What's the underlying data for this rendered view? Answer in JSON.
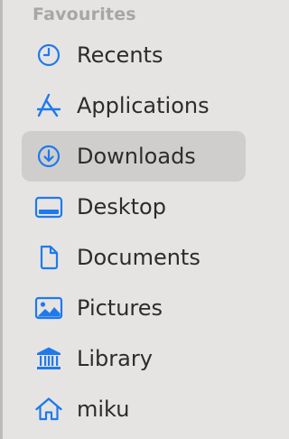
{
  "sidebar": {
    "section_title": "Favourites",
    "accent_color": "#1f7aec",
    "selected_index": 2,
    "items": [
      {
        "label": "Recents",
        "icon": "clock-icon",
        "selected": false
      },
      {
        "label": "Applications",
        "icon": "applications-icon",
        "selected": false
      },
      {
        "label": "Downloads",
        "icon": "download-icon",
        "selected": true
      },
      {
        "label": "Desktop",
        "icon": "desktop-icon",
        "selected": false
      },
      {
        "label": "Documents",
        "icon": "document-icon",
        "selected": false
      },
      {
        "label": "Pictures",
        "icon": "pictures-icon",
        "selected": false
      },
      {
        "label": "Library",
        "icon": "library-icon",
        "selected": false
      },
      {
        "label": "miku",
        "icon": "home-icon",
        "selected": false
      }
    ]
  }
}
